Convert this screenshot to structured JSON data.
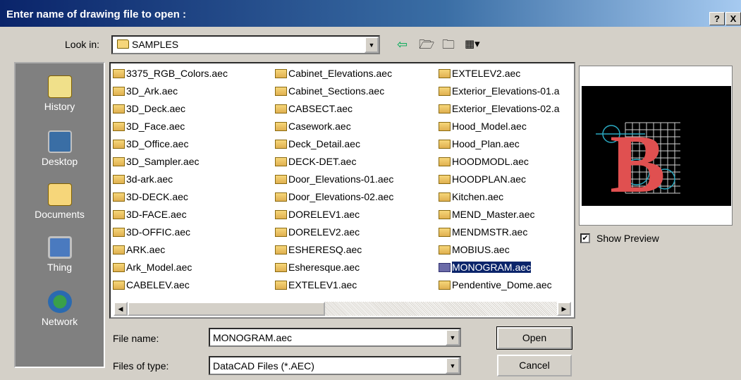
{
  "dialog": {
    "title": "Enter name of drawing file to open :",
    "help_label": "?",
    "close_label": "X"
  },
  "lookin": {
    "label": "Look in:",
    "value": "SAMPLES"
  },
  "sidebar": {
    "items": [
      {
        "label": "History",
        "icon": "history-icon"
      },
      {
        "label": "Desktop",
        "icon": "desktop-icon"
      },
      {
        "label": "Documents",
        "icon": "documents-icon"
      },
      {
        "label": "Thing",
        "icon": "computer-icon"
      },
      {
        "label": "Network",
        "icon": "network-icon"
      }
    ]
  },
  "files": {
    "col1": [
      "3375_RGB_Colors.aec",
      "3D_Ark.aec",
      "3D_Deck.aec",
      "3D_Face.aec",
      "3D_Office.aec",
      "3D_Sampler.aec",
      "3d-ark.aec",
      "3D-DECK.aec",
      "3D-FACE.aec",
      "3D-OFFIC.aec",
      "ARK.aec",
      "Ark_Model.aec",
      "CABELEV.aec"
    ],
    "col2": [
      "Cabinet_Elevations.aec",
      "Cabinet_Sections.aec",
      "CABSECT.aec",
      "Casework.aec",
      "Deck_Detail.aec",
      "DECK-DET.aec",
      "Door_Elevations-01.aec",
      "Door_Elevations-02.aec",
      "DORELEV1.aec",
      "DORELEV2.aec",
      "ESHERESQ.aec",
      "Esheresque.aec",
      "EXTELEV1.aec"
    ],
    "col3": [
      "EXTELEV2.aec",
      "Exterior_Elevations-01.a",
      "Exterior_Elevations-02.a",
      "Hood_Model.aec",
      "Hood_Plan.aec",
      "HOODMODL.aec",
      "HOODPLAN.aec",
      "Kitchen.aec",
      "MEND_Master.aec",
      "MENDMSTR.aec",
      "MOBIUS.aec",
      "MONOGRAM.aec",
      "Pendentive_Dome.aec"
    ],
    "selected": "MONOGRAM.aec"
  },
  "preview": {
    "show_label": "Show Preview",
    "checked": true
  },
  "filename": {
    "label": "File name:",
    "value": "MONOGRAM.aec"
  },
  "filetype": {
    "label": "Files of type:",
    "value": "DataCAD Files (*.AEC)"
  },
  "buttons": {
    "open": "Open",
    "cancel": "Cancel"
  },
  "colors": {
    "title_start": "#0a246a",
    "selection": "#0a246a",
    "face": "#d4d0c8"
  }
}
